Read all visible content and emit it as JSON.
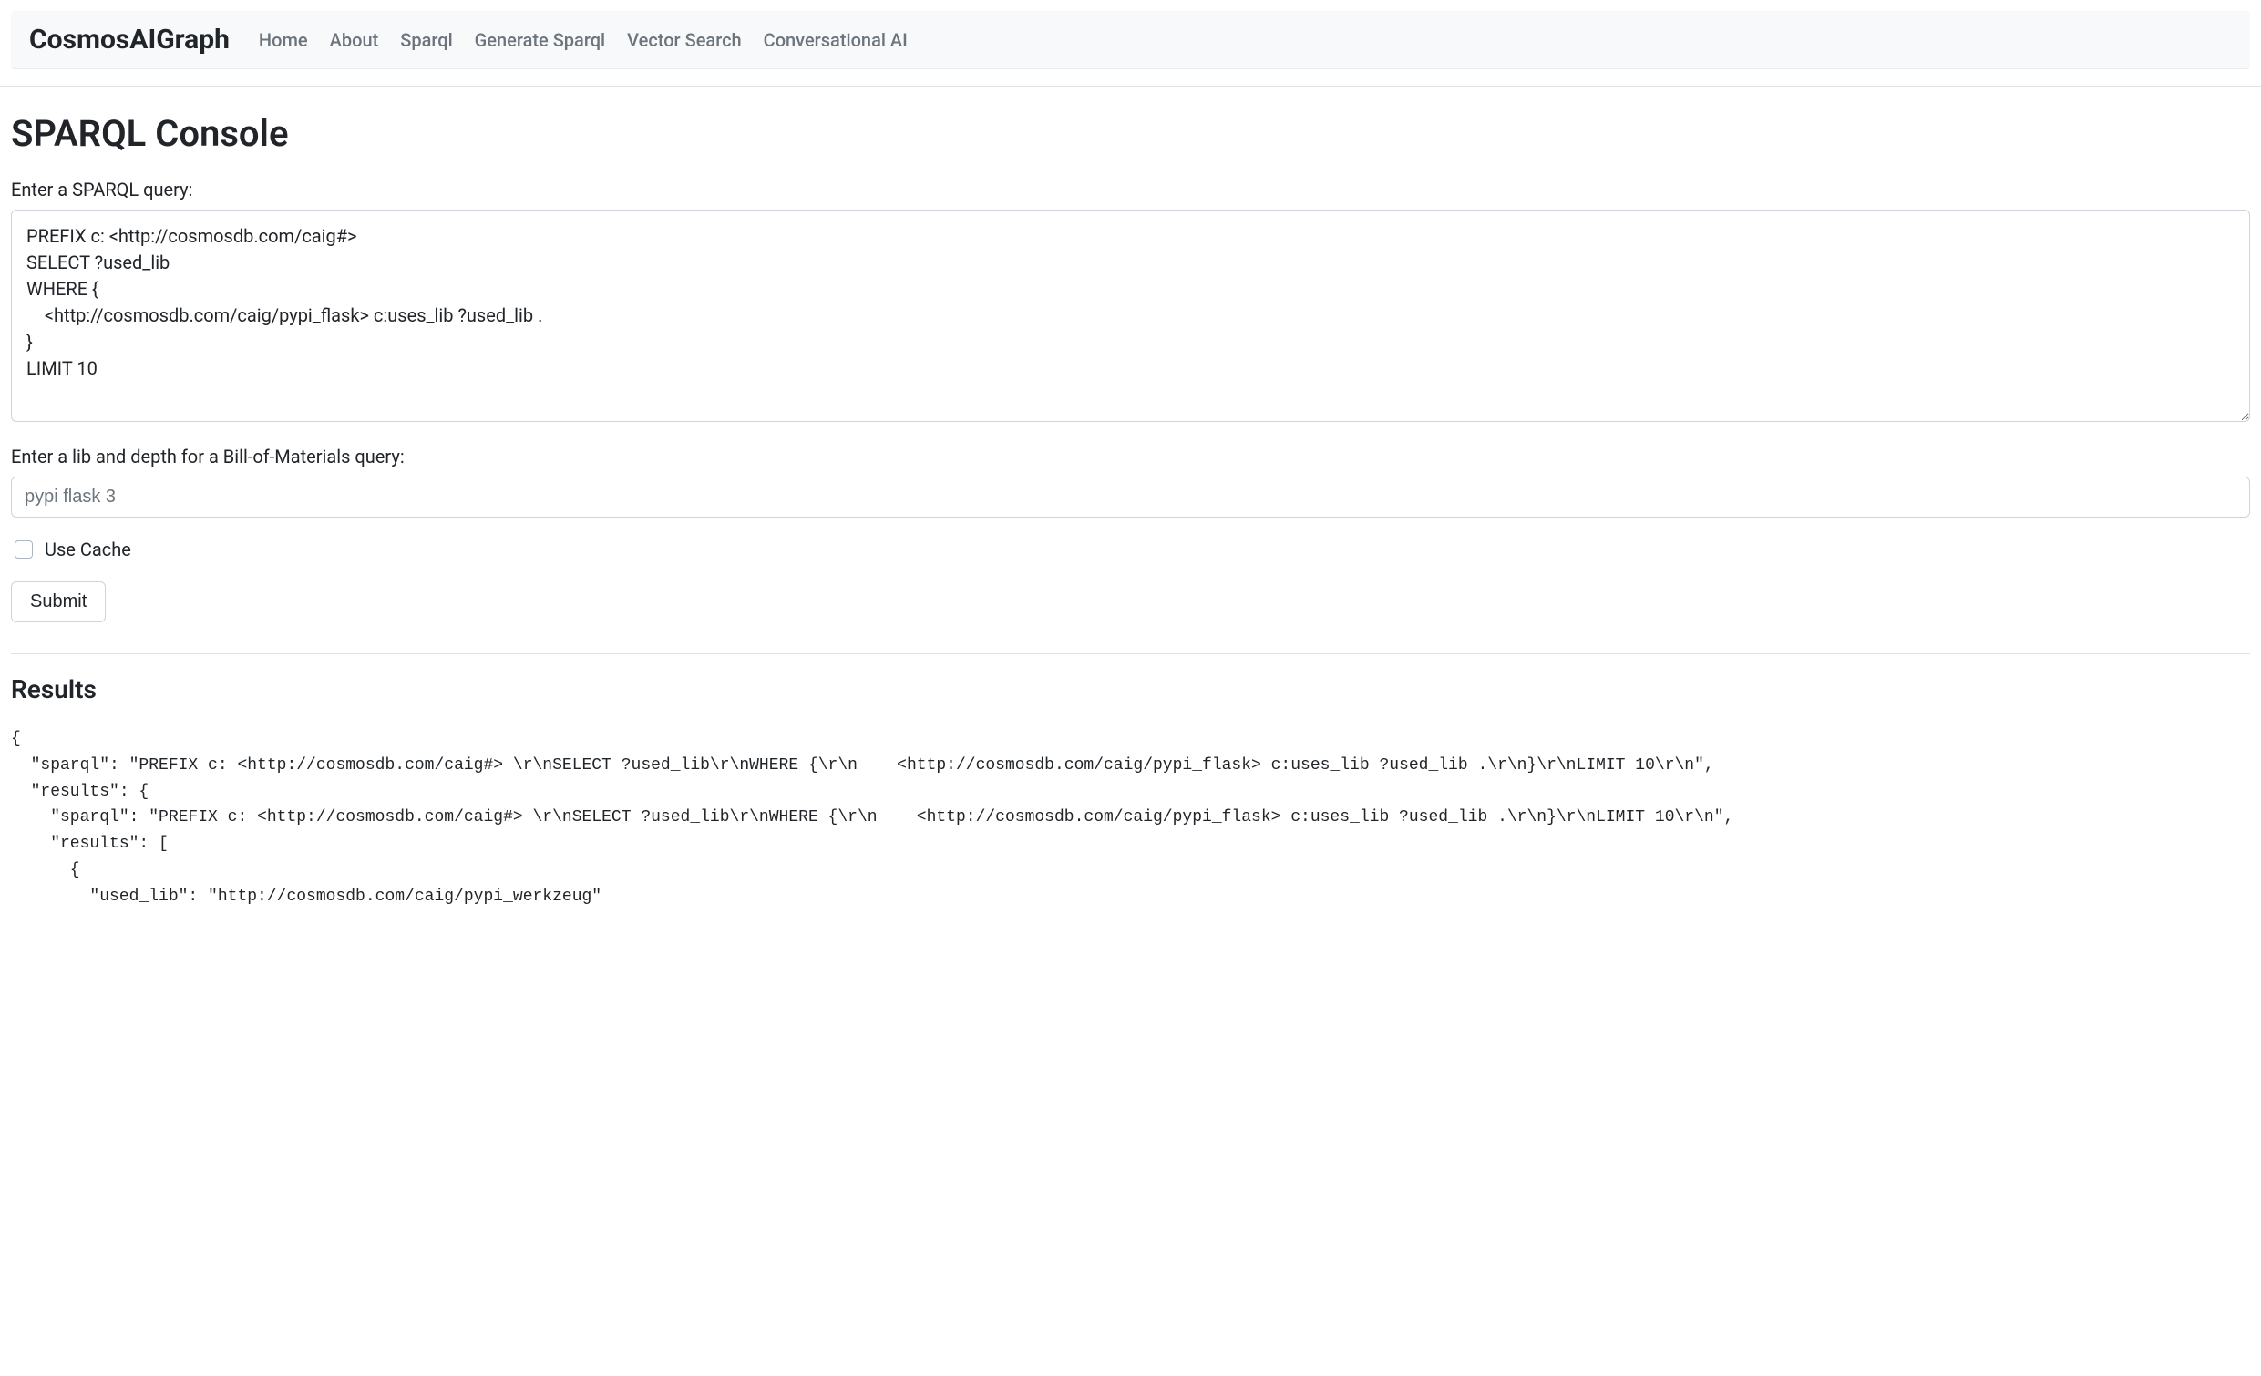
{
  "navbar": {
    "brand": "CosmosAIGraph",
    "links": [
      "Home",
      "About",
      "Sparql",
      "Generate Sparql",
      "Vector Search",
      "Conversational AI"
    ]
  },
  "page": {
    "title": "SPARQL Console"
  },
  "form": {
    "query_label": "Enter a SPARQL query:",
    "query_value": "PREFIX c: <http://cosmosdb.com/caig#>\nSELECT ?used_lib\nWHERE {\n    <http://cosmosdb.com/caig/pypi_flask> c:uses_lib ?used_lib .\n}\nLIMIT 10",
    "bom_label": "Enter a lib and depth for a Bill-of-Materials query:",
    "bom_placeholder": "pypi flask 3",
    "cache_label": "Use Cache",
    "submit_label": "Submit"
  },
  "results": {
    "title": "Results",
    "content": "{\n  \"sparql\": \"PREFIX c: <http://cosmosdb.com/caig#> \\r\\nSELECT ?used_lib\\r\\nWHERE {\\r\\n    <http://cosmosdb.com/caig/pypi_flask> c:uses_lib ?used_lib .\\r\\n}\\r\\nLIMIT 10\\r\\n\",\n  \"results\": {\n    \"sparql\": \"PREFIX c: <http://cosmosdb.com/caig#> \\r\\nSELECT ?used_lib\\r\\nWHERE {\\r\\n    <http://cosmosdb.com/caig/pypi_flask> c:uses_lib ?used_lib .\\r\\n}\\r\\nLIMIT 10\\r\\n\",\n    \"results\": [\n      {\n        \"used_lib\": \"http://cosmosdb.com/caig/pypi_werkzeug\""
  }
}
